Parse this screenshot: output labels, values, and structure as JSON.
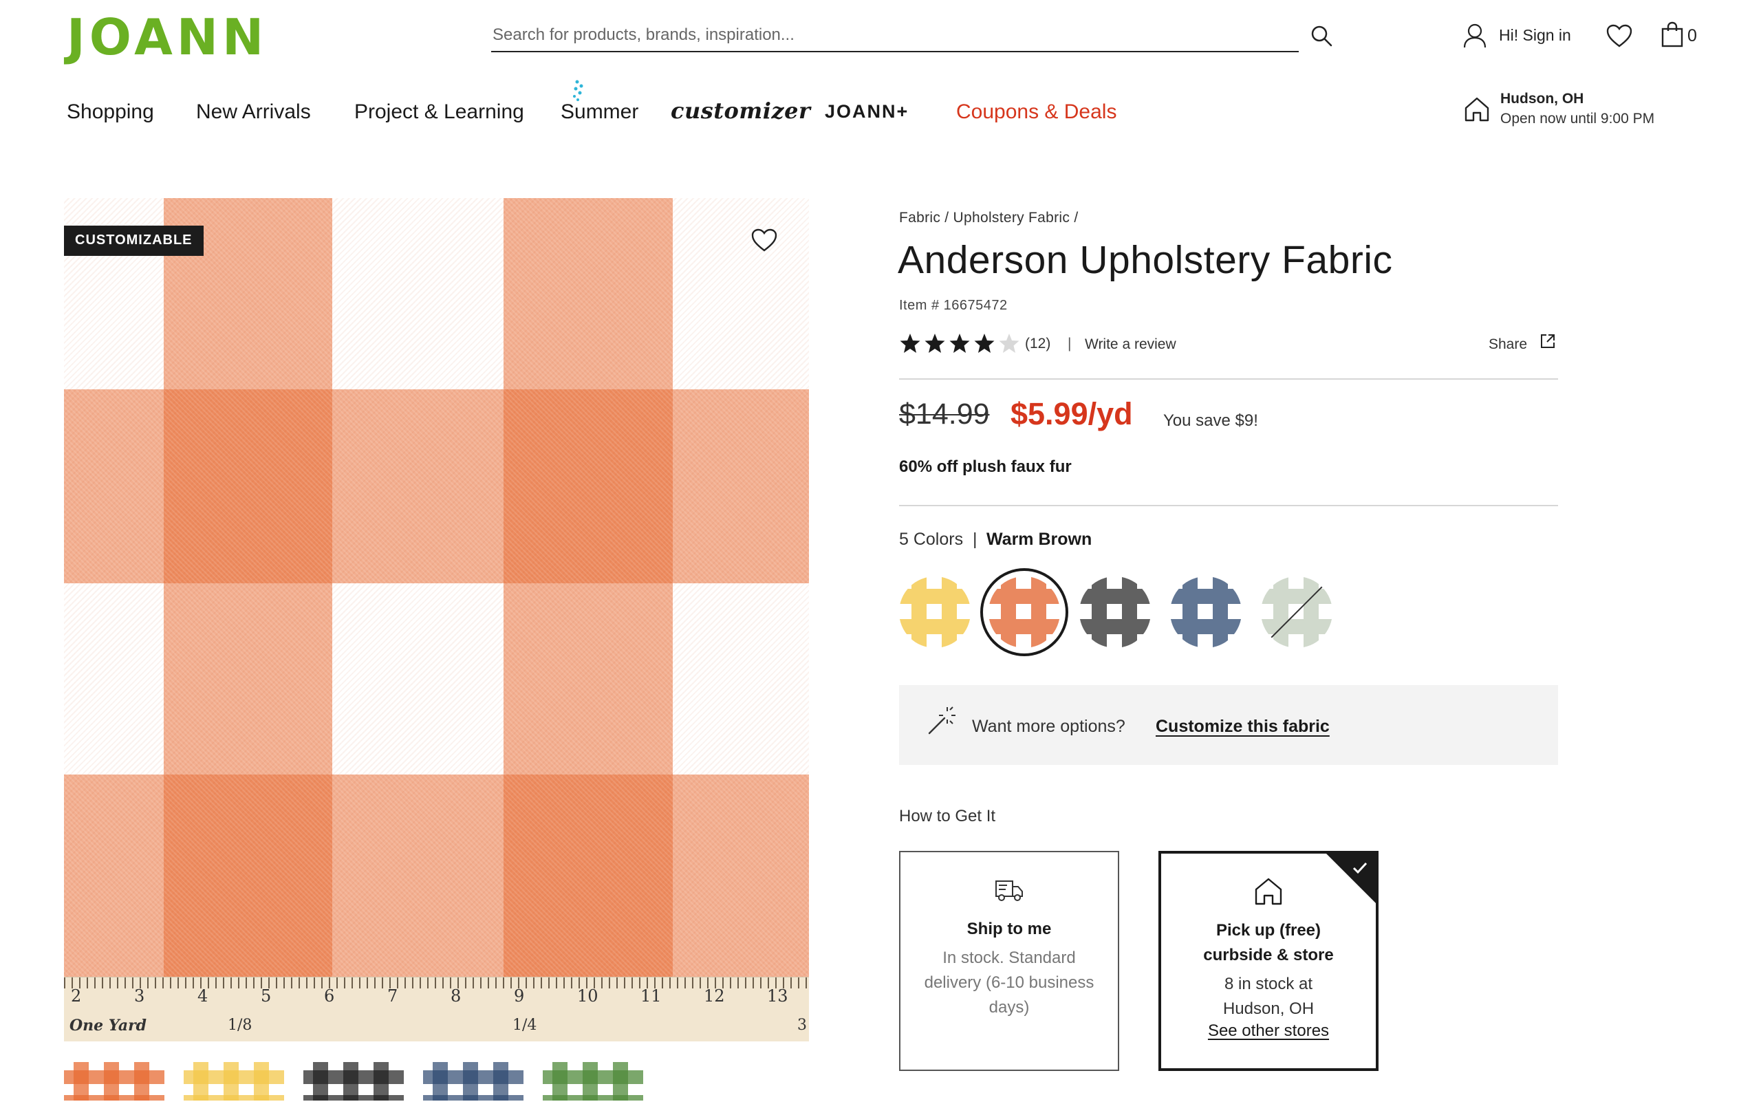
{
  "header": {
    "logo": "JOANN",
    "search_placeholder": "Search for products, brands, inspiration...",
    "account_label": "Hi! Sign in",
    "cart_count": "0"
  },
  "nav": {
    "items": [
      "Shopping",
      "New Arrivals",
      "Project & Learning",
      "Summer",
      "customizer",
      "JOANN+",
      "Coupons & Deals"
    ],
    "store": {
      "name": "Hudson, OH",
      "hours": "Open now until 9:00 PM"
    }
  },
  "image": {
    "badge": "CUSTOMIZABLE",
    "ruler_numbers": [
      "2",
      "3",
      "4",
      "5",
      "6",
      "7",
      "8",
      "9",
      "10",
      "11",
      "12",
      "13"
    ],
    "ruler_sub": [
      "One Yard",
      "1/8",
      "1/4",
      "3"
    ]
  },
  "product": {
    "breadcrumb": "Fabric / Upholstery Fabric /",
    "title": "Anderson Upholstery Fabric",
    "item_number": "Item # 16675472",
    "rating": 4,
    "rating_count": "(12)",
    "write_review": "Write a review",
    "share": "Share",
    "price_old": "$14.99",
    "price_new": "$5.99/yd",
    "price_save": "You save $9!",
    "promo": "60% off plush faux fur",
    "colors_count": "5 Colors",
    "selected_color": "Warm Brown",
    "swatch_colors": [
      "#f4c84a",
      "#e2602a",
      "#1f1f1f",
      "#2d4870",
      "#a9bba3"
    ],
    "customize_prompt": "Want more options?",
    "customize_link": "Customize this fabric",
    "how_to_get": "How to Get It",
    "ship": {
      "title": "Ship to me",
      "desc": "In stock. Standard delivery (6-10 business days)"
    },
    "pickup": {
      "title_line1": "Pick up (free)",
      "title_line2": "curbside & store",
      "desc": "8 in stock at Hudson, OH",
      "link": "See other stores"
    }
  },
  "colors": {
    "brand_green": "#6ab023",
    "sale_red": "#d6361c",
    "fabric_orange": "#e86c34"
  }
}
